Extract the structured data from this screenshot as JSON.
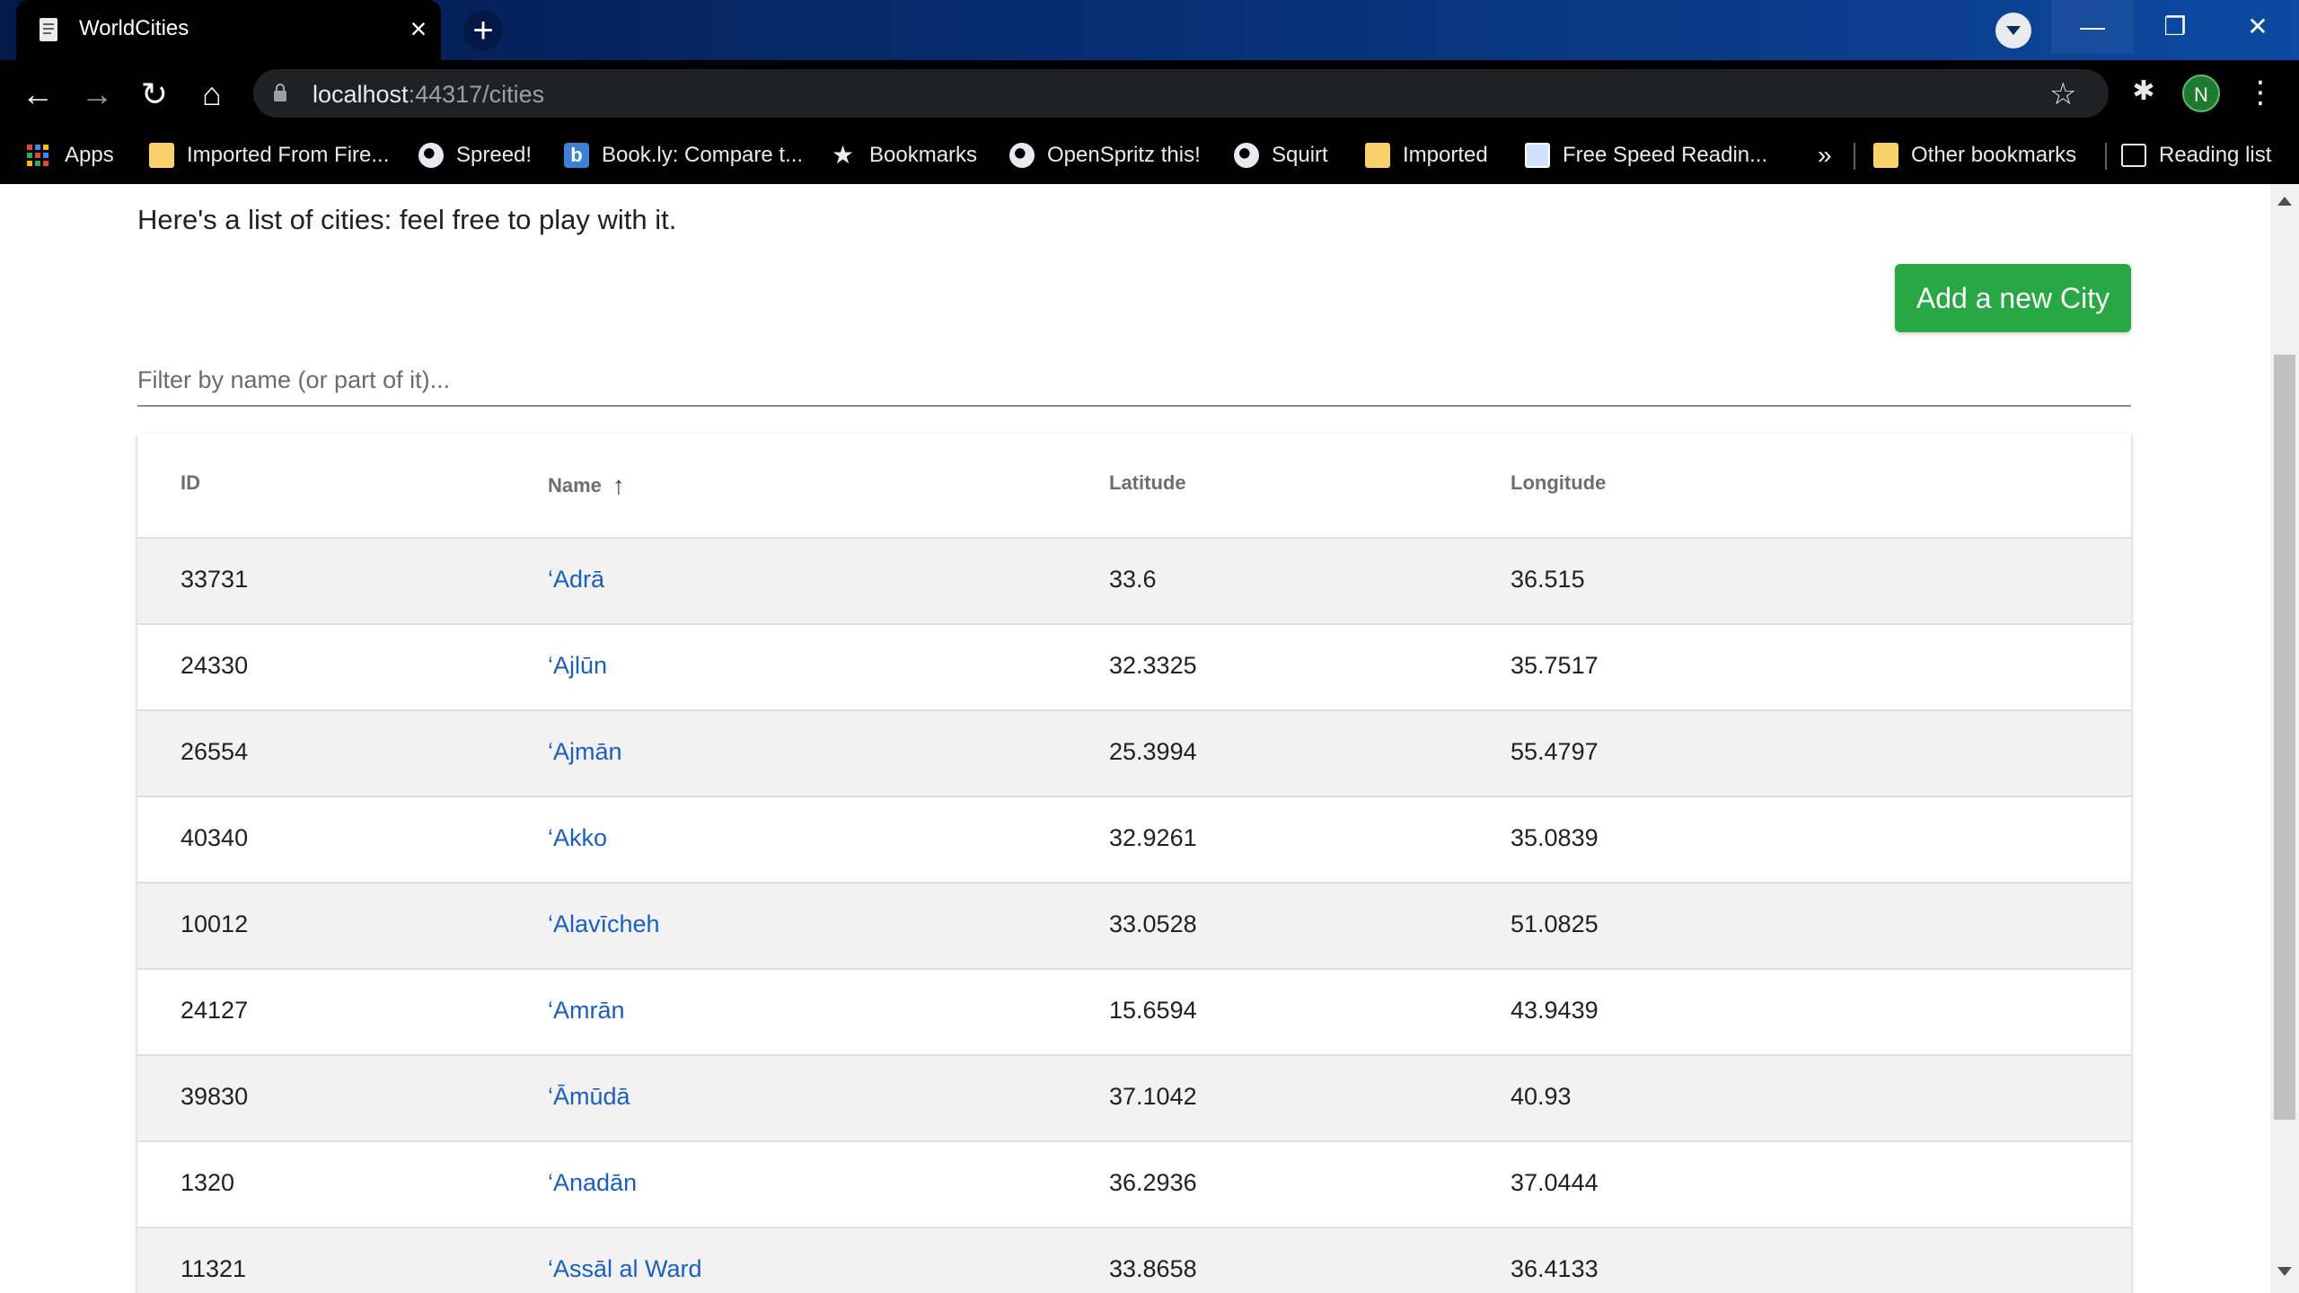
{
  "browser": {
    "tab_title": "WorldCities",
    "url_host": "localhost",
    "url_rest": ":44317/cities",
    "profile_initial": "N",
    "bookmarks": [
      {
        "label": "Apps",
        "icon": "apps-grid-icon"
      },
      {
        "label": "Imported From Fire...",
        "icon": "folder-icon"
      },
      {
        "label": "Spreed!",
        "icon": "globe-icon"
      },
      {
        "label": "Book.ly: Compare t...",
        "icon": "bookly-icon"
      },
      {
        "label": "Bookmarks",
        "icon": "star-icon"
      },
      {
        "label": "OpenSpritz this!",
        "icon": "globe-icon"
      },
      {
        "label": "Squirt",
        "icon": "globe-icon"
      },
      {
        "label": "Imported",
        "icon": "folder-icon"
      },
      {
        "label": "Free Speed Readin...",
        "icon": "book-icon"
      }
    ],
    "overflow": "»",
    "other_bookmarks": "Other bookmarks",
    "reading_list": "Reading list"
  },
  "page": {
    "intro": "Here's a list of cities: feel free to play with it.",
    "add_button": "Add a new City",
    "filter_placeholder": "Filter by name (or part of it)..."
  },
  "table": {
    "columns": [
      "ID",
      "Name",
      "Latitude",
      "Longitude"
    ],
    "sort_column": "Name",
    "sort_direction": "ascending",
    "rows": [
      {
        "id": "33731",
        "name": "‘Adrā",
        "lat": "33.6",
        "lon": "36.515"
      },
      {
        "id": "24330",
        "name": "‘Ajlūn",
        "lat": "32.3325",
        "lon": "35.7517"
      },
      {
        "id": "26554",
        "name": "‘Ajmān",
        "lat": "25.3994",
        "lon": "55.4797"
      },
      {
        "id": "40340",
        "name": "‘Akko",
        "lat": "32.9261",
        "lon": "35.0839"
      },
      {
        "id": "10012",
        "name": "‘Alavīcheh",
        "lat": "33.0528",
        "lon": "51.0825"
      },
      {
        "id": "24127",
        "name": "‘Amrān",
        "lat": "15.6594",
        "lon": "43.9439"
      },
      {
        "id": "39830",
        "name": "‘Āmūdā",
        "lat": "37.1042",
        "lon": "40.93"
      },
      {
        "id": "1320",
        "name": "‘Anadān",
        "lat": "36.2936",
        "lon": "37.0444"
      },
      {
        "id": "11321",
        "name": "‘Assāl al Ward",
        "lat": "33.8658",
        "lon": "36.4133"
      }
    ]
  },
  "colors": {
    "accent_button": "#28a745",
    "link": "#1a5fbf",
    "row_stripe": "#f2f2f2"
  }
}
